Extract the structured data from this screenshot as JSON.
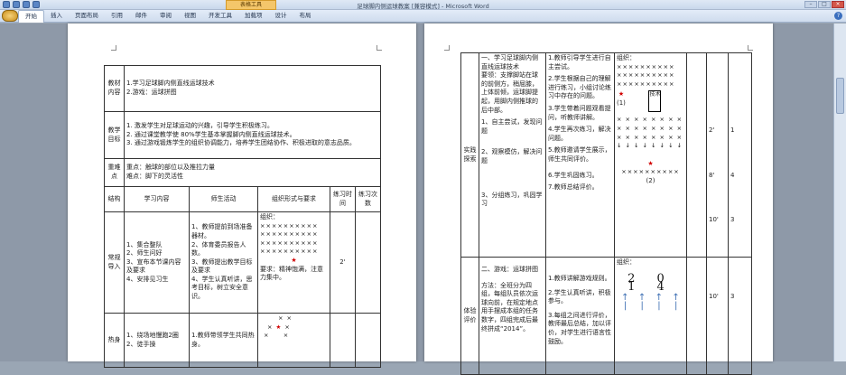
{
  "window": {
    "title": "足球脚内侧运球教案 [兼容模式] - Microsoft Word",
    "context_tab": "表格工具"
  },
  "ribbon": {
    "tabs": [
      "开始",
      "插入",
      "页面布局",
      "引用",
      "邮件",
      "审阅",
      "视图",
      "开发工具",
      "加载项",
      "设计",
      "布局"
    ],
    "active_tab": "开始"
  },
  "page1": {
    "r1": {
      "h": "教材内容",
      "l1": "1.学习足球脚内侧直线运球技术",
      "l2": "2.游戏：运球拼图"
    },
    "r2": {
      "h": "教学目标",
      "l1": "1. 激发学生对足球运动的兴趣，引导学生积极练习。",
      "l2": "2. 通过课堂教学使 80%学生基本掌握脚内侧直线运球技术。",
      "l3": "3. 通过游戏锻炼学生的组织协调能力，培养学生团结协作、积极进取的意志品质。"
    },
    "r3": {
      "h": "重难点",
      "l1": "重点：触球的部位以及推拉力量",
      "l2": "难点：脚下的灵活性"
    },
    "headers": {
      "structure": "结构",
      "content": "学习内容",
      "teacher": "师生活动",
      "org": "组织形式与要求",
      "time": "练习时间",
      "count": "练习次数"
    },
    "r5": {
      "h": "常规导入",
      "c1": "集合整队",
      "c2": "师生问好",
      "c3": "宣布本节课内容及要求",
      "c4": "安排见习生",
      "t1": "1、教师提前到场准备器材。",
      "t2": "2、体育委员报告人数。",
      "t3": "3、教师提出教学目标及要求",
      "t4": "4、学生认真听讲，思考目标，树立安全意识。",
      "org": "组织：",
      "rows": [
        "××××××××××",
        "××××××××××",
        "××××××××××",
        "××××××××××"
      ],
      "req": "要求：精神饱满，注意力集中。",
      "time": "2'"
    },
    "r6": {
      "h": "热身",
      "c1": "绕场地慢跑2圈",
      "c2": "徒手操",
      "t1": "1.教师带领学生共同热身。",
      "org": ""
    }
  },
  "page2": {
    "left": {
      "h": "实践探索",
      "a": "一、学习足球脚内侧直线运球技术",
      "b": "要领：支撑脚站在球的前侧方，稍屈膝，上体前倾，运球脚提起，用脚内侧推球的后中部。",
      "c": "1、自主尝试，发现问题",
      "d": "2、观察模仿，解决问题",
      "e": "3、分组练习，巩固学习"
    },
    "teacher": {
      "t1": "1.教师引导学生进行自主尝试。",
      "t2": "2.学生根据自己的理解进行练习，小组讨论练习中存在的问题。",
      "t3": "3.学生带着问题观看提问，听教师讲解。",
      "t4": "4.学生再次练习，解决问题。",
      "t5": "5.教师邀请学生展示，师生共同评价。",
      "t6": "6.学生巩固练习。",
      "t7": "7.教师总结评价。"
    },
    "org": {
      "label": "组织：",
      "rows": [
        "××××××××××",
        "××××××××××",
        "××××××××××"
      ],
      "box_text": "技术",
      "n1": "(1)",
      "n2": "(2)",
      "grid": [
        "× × × × × × × ×",
        "× × × × × × × ×",
        "× × × × × × × ×"
      ],
      "org2": "组织："
    },
    "times": {
      "a": "2'",
      "b": "8'",
      "c": "10'",
      "d": "10'"
    },
    "counts": {
      "a": "1",
      "b": "4",
      "c": "3",
      "d": "3"
    },
    "game": {
      "h": "体验评价",
      "a": "二、游戏：运球拼图",
      "b": "方法：全班分为四组，每组队员依次运球向前，在规定地点用手摆成本组的任务数字，四组完成后最终拼成“2014”。",
      "t1": "1.教师讲解游戏规则。",
      "t2": "2.学生认真听讲，积极参与。",
      "t3": "3.每组之间进行评价，教师最后总结，加以评价，对学生进行语言性鼓励。",
      "digits": "2 0 1 4"
    }
  }
}
